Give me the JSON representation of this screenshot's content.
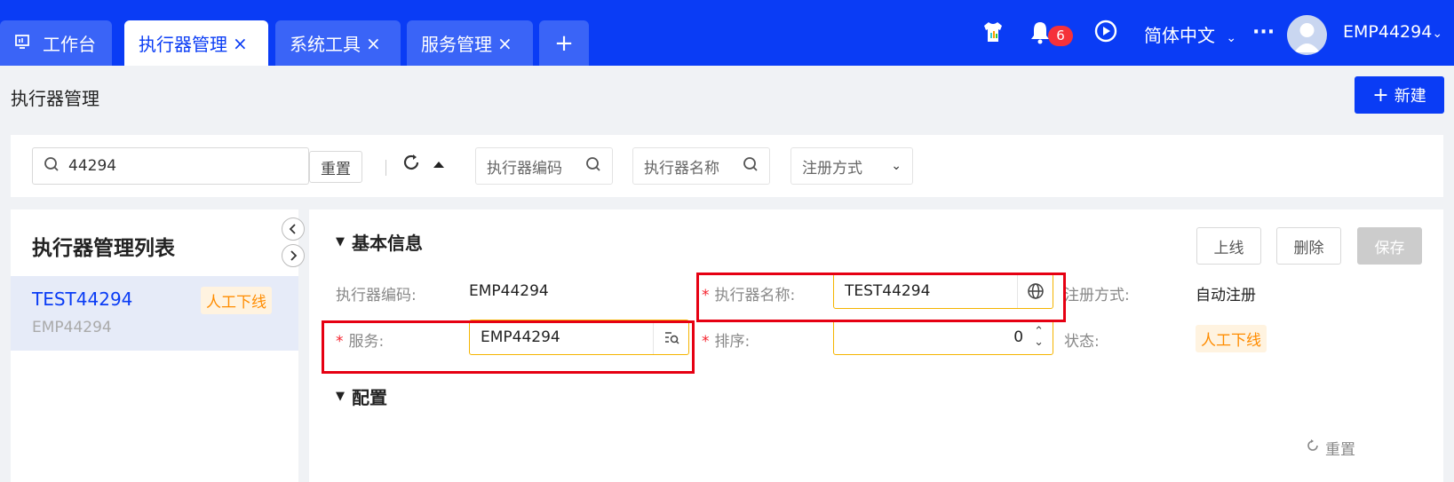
{
  "tabs": [
    {
      "label": "工作台",
      "icon": "monitor-icon"
    },
    {
      "label": "执行器管理",
      "close": "×"
    },
    {
      "label": "系统工具",
      "close": "×"
    },
    {
      "label": "服务管理",
      "close": "×"
    },
    {
      "label": "+"
    }
  ],
  "topbar": {
    "notification_count": "6",
    "language": "简体中文",
    "more": "···",
    "user": "EMP44294"
  },
  "page": {
    "title": "执行器管理",
    "new_button": "新建"
  },
  "filter": {
    "search_value": "44294",
    "reset_label": "重置",
    "code_placeholder": "执行器编码",
    "name_placeholder": "执行器名称",
    "register_placeholder": "注册方式"
  },
  "list": {
    "title": "执行器管理列表",
    "items": [
      {
        "name": "TEST44294",
        "code": "EMP44294",
        "status": "人工下线"
      }
    ]
  },
  "detail": {
    "basic_section": "基本信息",
    "config_section": "配置",
    "actions": {
      "online": "上线",
      "delete": "删除",
      "save": "保存"
    },
    "fields": {
      "code_label": "执行器编码:",
      "code_value": "EMP44294",
      "name_label": "执行器名称:",
      "name_value": "TEST44294",
      "register_label": "注册方式:",
      "register_value": "自动注册",
      "service_label": "服务:",
      "service_value": "EMP44294",
      "order_label": "排序:",
      "order_value": "0",
      "status_label": "状态:",
      "status_value": "人工下线"
    },
    "config_reset": "重置"
  },
  "colors": {
    "primary": "#0a3cf5",
    "highlight": "#e60012",
    "warning": "#ff8c00"
  }
}
